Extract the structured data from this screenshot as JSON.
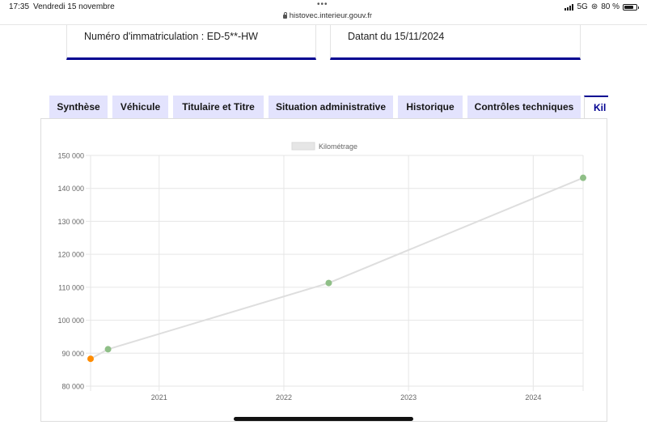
{
  "status_bar": {
    "time": "17:35",
    "date": "Vendredi 15 novembre",
    "url": "histovec.interieur.gouv.fr",
    "network": "5G",
    "battery": "80 %",
    "battery_level": 0.8,
    "tabs_indicator": "•••"
  },
  "cards": {
    "registration": "Numéro d'immatriculation : ED-5**-HW",
    "date": "Datant du 15/11/2024"
  },
  "tabs": [
    {
      "label": "Synthèse"
    },
    {
      "label": "Véhicule"
    },
    {
      "label": "Titulaire et Titre"
    },
    {
      "label": "Situation administrative"
    },
    {
      "label": "Historique"
    },
    {
      "label": "Contrôles techniques"
    },
    {
      "label": "Kil"
    }
  ],
  "active_tab": 6,
  "colors": {
    "accent": "#000091",
    "tab_bg": "#e3e3fd",
    "line": "#dedede",
    "point_green": "#8fbf87",
    "point_orange": "#ff8c00"
  },
  "chart_data": {
    "type": "line",
    "legend": "Kilométrage",
    "legend_position": "top",
    "x_axis": "time",
    "xlim": [
      2020.45,
      2024.4
    ],
    "x_ticks": [
      "2021",
      "2022",
      "2023",
      "2024"
    ],
    "y_ticks": [
      "80 000",
      "90 000",
      "100 000",
      "110 000",
      "120 000",
      "130 000",
      "140 000",
      "150 000"
    ],
    "ylim": [
      80000,
      150000
    ],
    "grid": true,
    "series": [
      {
        "name": "Kilométrage",
        "points": [
          {
            "x": 2020.45,
            "y": 88300,
            "color": "orange"
          },
          {
            "x": 2020.59,
            "y": 91200,
            "color": "green"
          },
          {
            "x": 2022.36,
            "y": 111300,
            "color": "green"
          },
          {
            "x": 2024.4,
            "y": 143200,
            "color": "green"
          }
        ]
      }
    ]
  }
}
